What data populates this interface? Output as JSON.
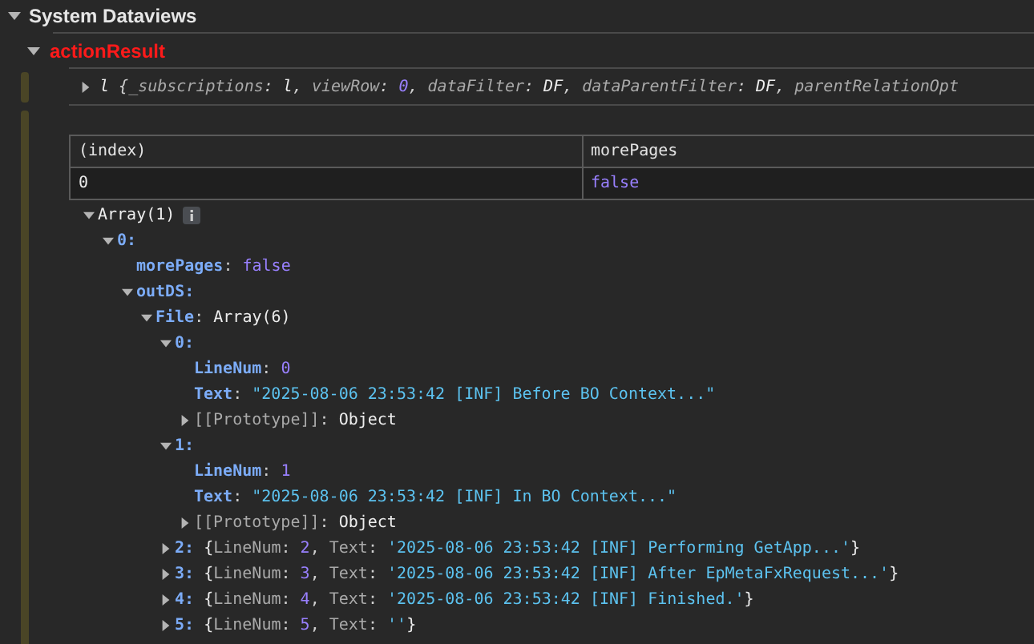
{
  "section": {
    "title": "System Dataviews",
    "expanded": true
  },
  "result": {
    "name": "actionResult",
    "expanded": true
  },
  "summary": {
    "expanded": false,
    "tokens": [
      {
        "text": "l ",
        "kind": "val"
      },
      {
        "text": "{",
        "kind": "punct"
      },
      {
        "text": "_subscriptions",
        "kind": "pkey"
      },
      {
        "text": ": ",
        "kind": "punct"
      },
      {
        "text": "l",
        "kind": "val"
      },
      {
        "text": ", ",
        "kind": "punct"
      },
      {
        "text": "viewRow",
        "kind": "pkey"
      },
      {
        "text": ": ",
        "kind": "punct"
      },
      {
        "text": "0",
        "kind": "num"
      },
      {
        "text": ", ",
        "kind": "punct"
      },
      {
        "text": "dataFilter",
        "kind": "pkey"
      },
      {
        "text": ": ",
        "kind": "punct"
      },
      {
        "text": "DF",
        "kind": "val"
      },
      {
        "text": ", ",
        "kind": "punct"
      },
      {
        "text": "dataParentFilter",
        "kind": "pkey"
      },
      {
        "text": ": ",
        "kind": "punct"
      },
      {
        "text": "DF",
        "kind": "val"
      },
      {
        "text": ", ",
        "kind": "punct"
      },
      {
        "text": "parentRelationOpt",
        "kind": "pkey"
      }
    ]
  },
  "table": {
    "columns": [
      "(index)",
      "morePages"
    ],
    "rows": [
      [
        {
          "text": "0",
          "kind": "val"
        },
        {
          "text": "false",
          "kind": "bool"
        }
      ]
    ]
  },
  "tree": [
    {
      "expanded": true,
      "info_badge": true,
      "tokens": [
        {
          "text": "Array(1)",
          "kind": "val"
        }
      ],
      "children": [
        {
          "expanded": true,
          "tokens": [
            {
              "text": "0:",
              "kind": "key"
            }
          ],
          "children": [
            {
              "tokens": [
                {
                  "text": "morePages",
                  "kind": "key"
                },
                {
                  "text": ": ",
                  "kind": "punct"
                },
                {
                  "text": "false",
                  "kind": "bool"
                }
              ]
            },
            {
              "expanded": true,
              "tokens": [
                {
                  "text": "outDS:",
                  "kind": "key"
                }
              ],
              "children": [
                {
                  "expanded": true,
                  "tokens": [
                    {
                      "text": "File",
                      "kind": "key"
                    },
                    {
                      "text": ": ",
                      "kind": "punct"
                    },
                    {
                      "text": "Array(6)",
                      "kind": "val"
                    }
                  ],
                  "children": [
                    {
                      "expanded": true,
                      "tokens": [
                        {
                          "text": "0:",
                          "kind": "key"
                        }
                      ],
                      "children": [
                        {
                          "tokens": [
                            {
                              "text": "LineNum",
                              "kind": "key"
                            },
                            {
                              "text": ": ",
                              "kind": "punct"
                            },
                            {
                              "text": "0",
                              "kind": "num"
                            }
                          ]
                        },
                        {
                          "tokens": [
                            {
                              "text": "Text",
                              "kind": "key"
                            },
                            {
                              "text": ": ",
                              "kind": "punct"
                            },
                            {
                              "text": "\"2025-08-06 23:53:42 [INF] Before BO Context...\"",
                              "kind": "str"
                            }
                          ]
                        },
                        {
                          "expanded": false,
                          "tokens": [
                            {
                              "text": "[[Prototype]]",
                              "kind": "dkey"
                            },
                            {
                              "text": ": ",
                              "kind": "punct"
                            },
                            {
                              "text": "Object",
                              "kind": "val"
                            }
                          ]
                        }
                      ]
                    },
                    {
                      "expanded": true,
                      "tokens": [
                        {
                          "text": "1:",
                          "kind": "key"
                        }
                      ],
                      "children": [
                        {
                          "tokens": [
                            {
                              "text": "LineNum",
                              "kind": "key"
                            },
                            {
                              "text": ": ",
                              "kind": "punct"
                            },
                            {
                              "text": "1",
                              "kind": "num"
                            }
                          ]
                        },
                        {
                          "tokens": [
                            {
                              "text": "Text",
                              "kind": "key"
                            },
                            {
                              "text": ": ",
                              "kind": "punct"
                            },
                            {
                              "text": "\"2025-08-06 23:53:42 [INF] In BO Context...\"",
                              "kind": "str"
                            }
                          ]
                        },
                        {
                          "expanded": false,
                          "tokens": [
                            {
                              "text": "[[Prototype]]",
                              "kind": "dkey"
                            },
                            {
                              "text": ": ",
                              "kind": "punct"
                            },
                            {
                              "text": "Object",
                              "kind": "val"
                            }
                          ]
                        }
                      ]
                    },
                    {
                      "expanded": false,
                      "tokens": [
                        {
                          "text": "2:",
                          "kind": "key"
                        },
                        {
                          "text": " {",
                          "kind": "val"
                        },
                        {
                          "text": "LineNum",
                          "kind": "pkey"
                        },
                        {
                          "text": ": ",
                          "kind": "punct"
                        },
                        {
                          "text": "2",
                          "kind": "num"
                        },
                        {
                          "text": ", ",
                          "kind": "punct"
                        },
                        {
                          "text": "Text",
                          "kind": "pkey"
                        },
                        {
                          "text": ": ",
                          "kind": "punct"
                        },
                        {
                          "text": "'2025-08-06 23:53:42 [INF] Performing GetApp...'",
                          "kind": "str"
                        },
                        {
                          "text": "}",
                          "kind": "val"
                        }
                      ]
                    },
                    {
                      "expanded": false,
                      "tokens": [
                        {
                          "text": "3:",
                          "kind": "key"
                        },
                        {
                          "text": " {",
                          "kind": "val"
                        },
                        {
                          "text": "LineNum",
                          "kind": "pkey"
                        },
                        {
                          "text": ": ",
                          "kind": "punct"
                        },
                        {
                          "text": "3",
                          "kind": "num"
                        },
                        {
                          "text": ", ",
                          "kind": "punct"
                        },
                        {
                          "text": "Text",
                          "kind": "pkey"
                        },
                        {
                          "text": ": ",
                          "kind": "punct"
                        },
                        {
                          "text": "'2025-08-06 23:53:42 [INF] After EpMetaFxRequest...'",
                          "kind": "str"
                        },
                        {
                          "text": "}",
                          "kind": "val"
                        }
                      ]
                    },
                    {
                      "expanded": false,
                      "tokens": [
                        {
                          "text": "4:",
                          "kind": "key"
                        },
                        {
                          "text": " {",
                          "kind": "val"
                        },
                        {
                          "text": "LineNum",
                          "kind": "pkey"
                        },
                        {
                          "text": ": ",
                          "kind": "punct"
                        },
                        {
                          "text": "4",
                          "kind": "num"
                        },
                        {
                          "text": ", ",
                          "kind": "punct"
                        },
                        {
                          "text": "Text",
                          "kind": "pkey"
                        },
                        {
                          "text": ": ",
                          "kind": "punct"
                        },
                        {
                          "text": "'2025-08-06 23:53:42 [INF] Finished.'",
                          "kind": "str"
                        },
                        {
                          "text": "}",
                          "kind": "val"
                        }
                      ]
                    },
                    {
                      "expanded": false,
                      "tokens": [
                        {
                          "text": "5:",
                          "kind": "key"
                        },
                        {
                          "text": " {",
                          "kind": "val"
                        },
                        {
                          "text": "LineNum",
                          "kind": "pkey"
                        },
                        {
                          "text": ": ",
                          "kind": "punct"
                        },
                        {
                          "text": "5",
                          "kind": "num"
                        },
                        {
                          "text": ", ",
                          "kind": "punct"
                        },
                        {
                          "text": "Text",
                          "kind": "pkey"
                        },
                        {
                          "text": ": ",
                          "kind": "punct"
                        },
                        {
                          "text": "''",
                          "kind": "str"
                        },
                        {
                          "text": "}",
                          "kind": "val"
                        }
                      ]
                    }
                  ]
                }
              ]
            }
          ]
        }
      ]
    }
  ]
}
